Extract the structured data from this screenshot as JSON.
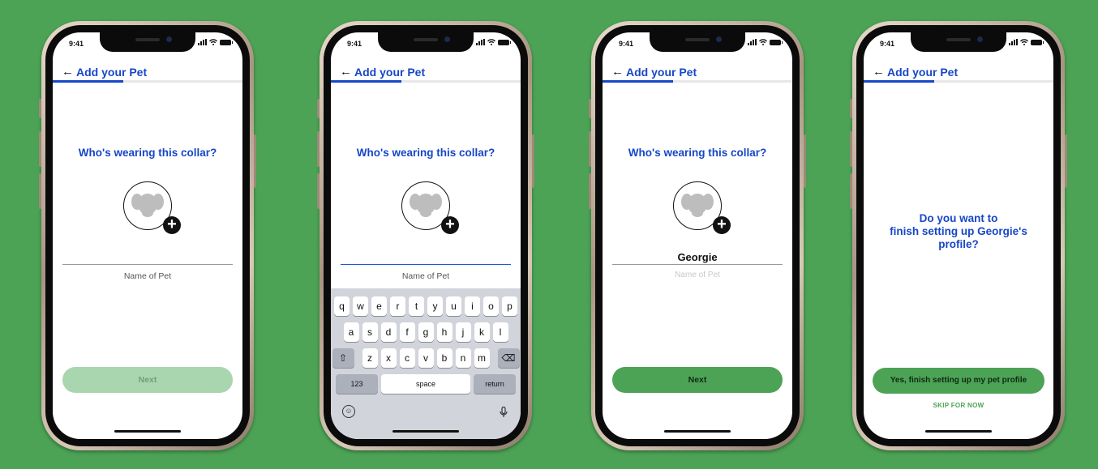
{
  "colors": {
    "background": "#4ca355",
    "brand_blue": "#1747c7",
    "brand_green": "#4ca355",
    "disabled_green": "#a9d5af"
  },
  "status_bar": {
    "time": "9:41"
  },
  "screens": [
    {
      "header_title": "Add your Pet",
      "back_icon": "←",
      "progress": 0.37,
      "question": "Who's wearing this collar?",
      "name_label": "Name of Pet",
      "name_value": "",
      "next_label": "Next",
      "next_enabled": false
    },
    {
      "header_title": "Add your Pet",
      "back_icon": "←",
      "progress": 0.37,
      "question": "Who's wearing this collar?",
      "name_label": "Name of Pet",
      "name_value": "",
      "keyboard": {
        "row1": [
          "q",
          "w",
          "e",
          "r",
          "t",
          "y",
          "u",
          "i",
          "o",
          "p"
        ],
        "row2": [
          "a",
          "s",
          "d",
          "f",
          "g",
          "h",
          "j",
          "k",
          "l"
        ],
        "row3": [
          "z",
          "x",
          "c",
          "v",
          "b",
          "n",
          "m"
        ],
        "shift_icon": "⇧",
        "delete_icon": "⌫",
        "numbers_key": "123",
        "space_key": "space",
        "return_key": "return",
        "emoji_icon": "☺",
        "mic_icon": "🎙"
      }
    },
    {
      "header_title": "Add your Pet",
      "back_icon": "←",
      "progress": 0.37,
      "question": "Who's wearing this collar?",
      "name_label": "Name of Pet",
      "name_value": "Georgie",
      "next_label": "Next",
      "next_enabled": true
    },
    {
      "header_title": "Add your Pet",
      "back_icon": "←",
      "progress": 0.37,
      "confirm_question": "Do you want to finish setting up Georgie's profile?",
      "confirm_line1": "Do you want to",
      "confirm_line2": "finish setting up Georgie's",
      "confirm_line3": "profile?",
      "yes_label": "Yes, finish setting up my pet profile",
      "skip_label": "SKIP FOR NOW"
    }
  ]
}
